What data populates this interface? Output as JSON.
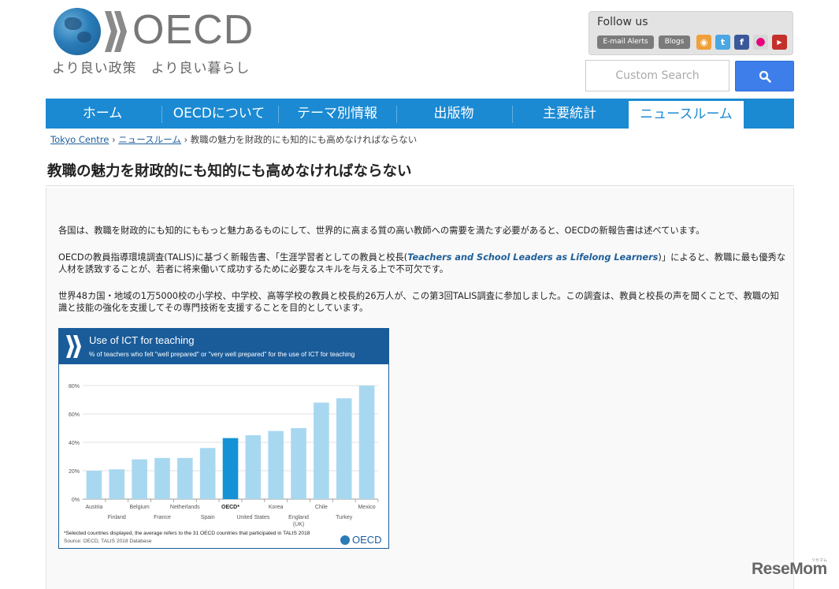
{
  "header": {
    "logo_text": "OECD",
    "tagline": "より良い政策　より良い暮らし",
    "follow_title": "Follow us",
    "email_alerts": "E-mail Alerts",
    "blogs": "Blogs",
    "search_placeholder": "Custom Search"
  },
  "nav": {
    "items": [
      "ホーム",
      "OECDについて",
      "テーマ別情報",
      "出版物",
      "主要統計",
      "ニュースルーム"
    ],
    "active": "ニュースルーム",
    "color": "#1b8ad3"
  },
  "breadcrumb": {
    "items": [
      "Tokyo Centre",
      "ニュースルーム",
      "教職の魅力を財政的にも知的にも高めなければならない"
    ],
    "separator": "›"
  },
  "page_title": "教職の魅力を財政的にも知的にも高めなければならない",
  "article": {
    "p1": "各国は、教職を財政的にも知的にももっと魅力あるものにして、世界的に高まる質の高い教師への需要を満たす必要があると、OECDの新報告書は述べています。",
    "p2_before": "OECDの教員指導環境調査(TALIS)に基づく新報告書、「生涯学習者としての教員と校長(",
    "p2_link": "Teachers and School Leaders as Lifelong Learners",
    "p2_after": ")」によると、教職に最も優秀な人材を誘致することが、若者に将来働いて成功するために必要なスキルを与える上で不可欠です。",
    "p3": "世界48カ国・地域の1万5000校の小学校、中学校、高等学校の教員と校長約26万人が、この第3回TALIS調査に参加しました。この調査は、教員と校長の声を聞くことで、教職の知識と技能の強化を支援してその専門技術を支援することを目的としています。"
  },
  "chart_data": {
    "type": "bar",
    "title": "Use of ICT for teaching",
    "subtitle": "% of teachers who felt \"well prepared\" or \"very well prepared\" for the use of ICT for teaching",
    "categories": [
      "Austria",
      "Finland",
      "Belgium",
      "France",
      "Netherlands",
      "Spain",
      "OECD*",
      "United States",
      "Korea",
      "England (UK)",
      "Chile",
      "Turkey",
      "Mexico"
    ],
    "values": [
      20,
      21,
      28,
      29,
      29,
      36,
      43,
      45,
      48,
      50,
      68,
      71,
      80
    ],
    "highlight": "OECD*",
    "ylim": [
      0,
      80
    ],
    "yticks": [
      "0%",
      "20%",
      "40%",
      "60%",
      "80%"
    ],
    "bar_color": "#a8d8f0",
    "highlight_color": "#1592d6",
    "note": "*Selected countries displayed, the average refers to the 31 OECD countries that participated in TALIS 2018",
    "source": "Source: OECD, TALIS 2018 Database",
    "logo": "OECD"
  },
  "watermark": "ReseMom",
  "watermark_sub": "リセマム"
}
